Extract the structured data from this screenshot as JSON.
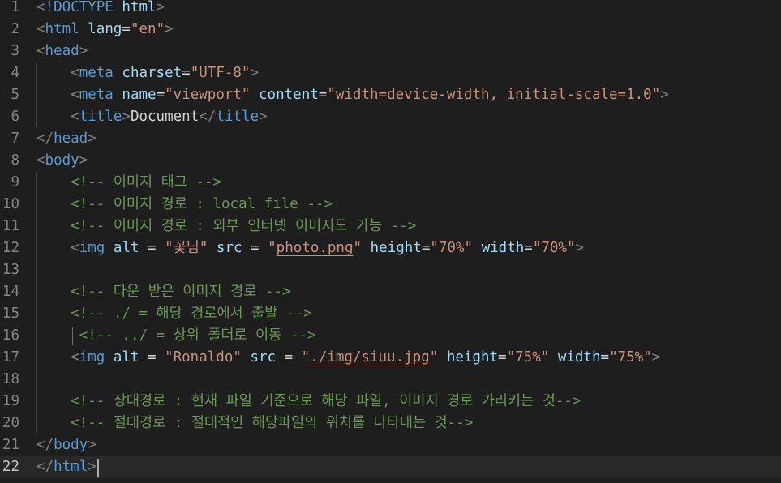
{
  "editor": {
    "current_line": 22,
    "lines": [
      {
        "n": "1",
        "tokens": [
          [
            "punct",
            "<"
          ],
          [
            "tag",
            "!DOCTYPE"
          ],
          [
            "text",
            " "
          ],
          [
            "attr",
            "html"
          ],
          [
            "punct",
            ">"
          ]
        ]
      },
      {
        "n": "2",
        "tokens": [
          [
            "punct",
            "<"
          ],
          [
            "tag",
            "html"
          ],
          [
            "text",
            " "
          ],
          [
            "attr",
            "lang"
          ],
          [
            "text",
            "="
          ],
          [
            "str",
            "\"en\""
          ],
          [
            "punct",
            ">"
          ]
        ]
      },
      {
        "n": "3",
        "tokens": [
          [
            "punct",
            "<"
          ],
          [
            "tag",
            "head"
          ],
          [
            "punct",
            ">"
          ]
        ]
      },
      {
        "n": "4",
        "tokens": [
          [
            "text",
            "    "
          ],
          [
            "punct",
            "<"
          ],
          [
            "tag",
            "meta"
          ],
          [
            "text",
            " "
          ],
          [
            "attr",
            "charset"
          ],
          [
            "text",
            "="
          ],
          [
            "str",
            "\"UTF-8\""
          ],
          [
            "punct",
            ">"
          ]
        ]
      },
      {
        "n": "5",
        "tokens": [
          [
            "text",
            "    "
          ],
          [
            "punct",
            "<"
          ],
          [
            "tag",
            "meta"
          ],
          [
            "text",
            " "
          ],
          [
            "attr",
            "name"
          ],
          [
            "text",
            "="
          ],
          [
            "str",
            "\"viewport\""
          ],
          [
            "text",
            " "
          ],
          [
            "attr",
            "content"
          ],
          [
            "text",
            "="
          ],
          [
            "str",
            "\"width=device-width, initial-scale=1.0\""
          ],
          [
            "punct",
            ">"
          ]
        ]
      },
      {
        "n": "6",
        "tokens": [
          [
            "text",
            "    "
          ],
          [
            "punct",
            "<"
          ],
          [
            "tag",
            "title"
          ],
          [
            "punct",
            ">"
          ],
          [
            "text",
            "Document"
          ],
          [
            "punct",
            "</"
          ],
          [
            "tag",
            "title"
          ],
          [
            "punct",
            ">"
          ]
        ]
      },
      {
        "n": "7",
        "tokens": [
          [
            "punct",
            "</"
          ],
          [
            "tag",
            "head"
          ],
          [
            "punct",
            ">"
          ]
        ]
      },
      {
        "n": "8",
        "tokens": [
          [
            "punct",
            "<"
          ],
          [
            "tag",
            "body"
          ],
          [
            "punct",
            ">"
          ]
        ]
      },
      {
        "n": "9",
        "tokens": [
          [
            "text",
            "    "
          ],
          [
            "comment",
            "<!-- 이미지 태그 -->"
          ]
        ]
      },
      {
        "n": "10",
        "tokens": [
          [
            "text",
            "    "
          ],
          [
            "comment",
            "<!-- 이미지 경로 : local file -->"
          ]
        ]
      },
      {
        "n": "11",
        "tokens": [
          [
            "text",
            "    "
          ],
          [
            "comment",
            "<!-- 이미지 경로 : 외부 인터넷 이미지도 가능 -->"
          ]
        ]
      },
      {
        "n": "12",
        "tokens": [
          [
            "text",
            "    "
          ],
          [
            "punct",
            "<"
          ],
          [
            "tag",
            "img"
          ],
          [
            "text",
            " "
          ],
          [
            "attr",
            "alt"
          ],
          [
            "text",
            " = "
          ],
          [
            "str",
            "\"꽃님\""
          ],
          [
            "text",
            " "
          ],
          [
            "attr",
            "src"
          ],
          [
            "text",
            " = "
          ],
          [
            "str",
            "\""
          ],
          [
            "link",
            "photo.png"
          ],
          [
            "str",
            "\""
          ],
          [
            "text",
            " "
          ],
          [
            "attr",
            "height"
          ],
          [
            "text",
            "="
          ],
          [
            "str",
            "\"70%\""
          ],
          [
            "text",
            " "
          ],
          [
            "attr",
            "width"
          ],
          [
            "text",
            "="
          ],
          [
            "str",
            "\"70%\""
          ],
          [
            "punct",
            ">"
          ]
        ]
      },
      {
        "n": "13",
        "tokens": []
      },
      {
        "n": "14",
        "tokens": [
          [
            "text",
            "    "
          ],
          [
            "comment",
            "<!-- 다운 받은 이미지 경로 -->"
          ]
        ]
      },
      {
        "n": "15",
        "tokens": [
          [
            "text",
            "    "
          ],
          [
            "comment",
            "<!-- ./ = 해당 경로에서 출발 -->"
          ]
        ]
      },
      {
        "n": "16",
        "tokens": [
          [
            "text",
            "     "
          ],
          [
            "comment",
            "<!-- ../ = 상위 폴더로 이동 -->"
          ]
        ]
      },
      {
        "n": "17",
        "tokens": [
          [
            "text",
            "    "
          ],
          [
            "punct",
            "<"
          ],
          [
            "tag",
            "img"
          ],
          [
            "text",
            " "
          ],
          [
            "attr",
            "alt"
          ],
          [
            "text",
            " = "
          ],
          [
            "str",
            "\"Ronaldo\""
          ],
          [
            "text",
            " "
          ],
          [
            "attr",
            "src"
          ],
          [
            "text",
            " = "
          ],
          [
            "str",
            "\""
          ],
          [
            "link",
            "./img/siuu.jpg"
          ],
          [
            "str",
            "\""
          ],
          [
            "text",
            " "
          ],
          [
            "attr",
            "height"
          ],
          [
            "text",
            "="
          ],
          [
            "str",
            "\"75%\""
          ],
          [
            "text",
            " "
          ],
          [
            "attr",
            "width"
          ],
          [
            "text",
            "="
          ],
          [
            "str",
            "\"75%\""
          ],
          [
            "punct",
            ">"
          ]
        ]
      },
      {
        "n": "18",
        "tokens": []
      },
      {
        "n": "19",
        "tokens": [
          [
            "text",
            "    "
          ],
          [
            "comment",
            "<!-- 상대경로 : 현재 파일 기준으로 해당 파일, 이미지 경로 가리키는 것-->"
          ]
        ]
      },
      {
        "n": "20",
        "tokens": [
          [
            "text",
            "    "
          ],
          [
            "comment",
            "<!-- 절대경로 : 절대적인 해당파일의 위치를 나타내는 것-->"
          ]
        ]
      },
      {
        "n": "21",
        "tokens": [
          [
            "punct",
            "</"
          ],
          [
            "tag",
            "body"
          ],
          [
            "punct",
            ">"
          ]
        ]
      },
      {
        "n": "22",
        "tokens": [
          [
            "punct",
            "</"
          ],
          [
            "tag",
            "html"
          ],
          [
            "punct",
            ">"
          ]
        ]
      }
    ]
  }
}
